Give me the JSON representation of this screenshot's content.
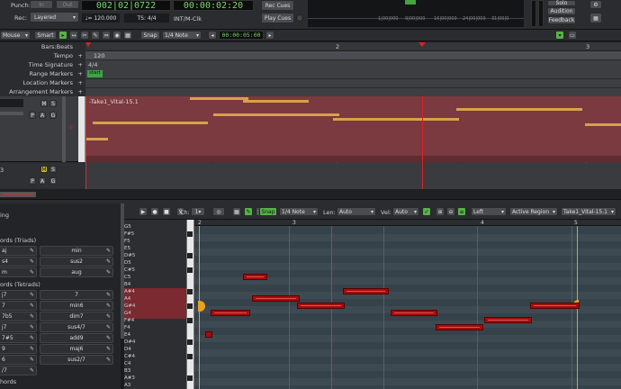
{
  "transport": {
    "punch_label": "Punch:",
    "in_label": "In",
    "out_label": "Out",
    "rec_label": "Rec:",
    "rec_mode": "Layered",
    "bbt": "002|02|0722",
    "timecode": "00:00:02:20",
    "tempo": "♩= 120.000",
    "ts": "TS: 4/4",
    "sync": "INT/M-Clk",
    "rec_cues": "Rec Cues",
    "play_cues": "Play Cues",
    "solo": "Solo",
    "audition": "Audition",
    "feedback": "Feedback",
    "mini_ticks": [
      "1|00|000",
      "9|00|000",
      "16|00|000",
      "24|00|000",
      "31|00|0"
    ]
  },
  "toolbar": {
    "mouse": "Mouse",
    "smart": "Smart",
    "snap": "Snap",
    "snap_value": "1/4 Note",
    "nudge_clock": "00:00:05:00"
  },
  "rulers": [
    "Bars:Beats",
    "Tempo",
    "Time Signature",
    "Range Markers",
    "Location Markers",
    "Arrangement Markers"
  ],
  "ruler_values": {
    "tempo": "120",
    "ts": "4/4",
    "range": "start"
  },
  "bar_numbers": [
    "2",
    "3"
  ],
  "region": {
    "name": "-Take1_Vital-15.1"
  },
  "piano_roll": {
    "channel_label": "Ch:",
    "channel": "1",
    "snap": "Snap",
    "note_len": "1/4 Note",
    "len_label": "Len:",
    "len_value": "Auto",
    "vel_label": "Vel:",
    "vel_value": "Auto",
    "direction": "Left",
    "region_mode": "Active Region",
    "region_name": "Take1_Vital-15.1",
    "bars": [
      "2",
      "3",
      "4",
      "5"
    ],
    "note_names": [
      "G5",
      "F#5",
      "F5",
      "E5",
      "D#5",
      "D5",
      "C#5",
      "C5",
      "B4",
      "A#4",
      "A4",
      "G#4",
      "G4",
      "F#4",
      "F4",
      "E4",
      "D#4",
      "D4",
      "C#4",
      "C4",
      "B3",
      "A#3",
      "A3"
    ]
  },
  "chords": {
    "header": "ing",
    "triads_title": "ords (Triads)",
    "tetrads_title": "ords (Tetrads)",
    "footer": "hords",
    "triads": [
      [
        "aj",
        "min"
      ],
      [
        "s4",
        "sus2"
      ],
      [
        "m",
        "aug"
      ]
    ],
    "tetrads": [
      [
        "j7",
        "7"
      ],
      [
        "7",
        "min6"
      ],
      [
        "7b5",
        "dim7"
      ],
      [
        "j7",
        "sus4/7"
      ],
      [
        "7#5",
        "add9"
      ],
      [
        "9",
        "maj6"
      ],
      [
        "6",
        "sus2/7"
      ],
      [
        "/7",
        ""
      ]
    ]
  }
}
